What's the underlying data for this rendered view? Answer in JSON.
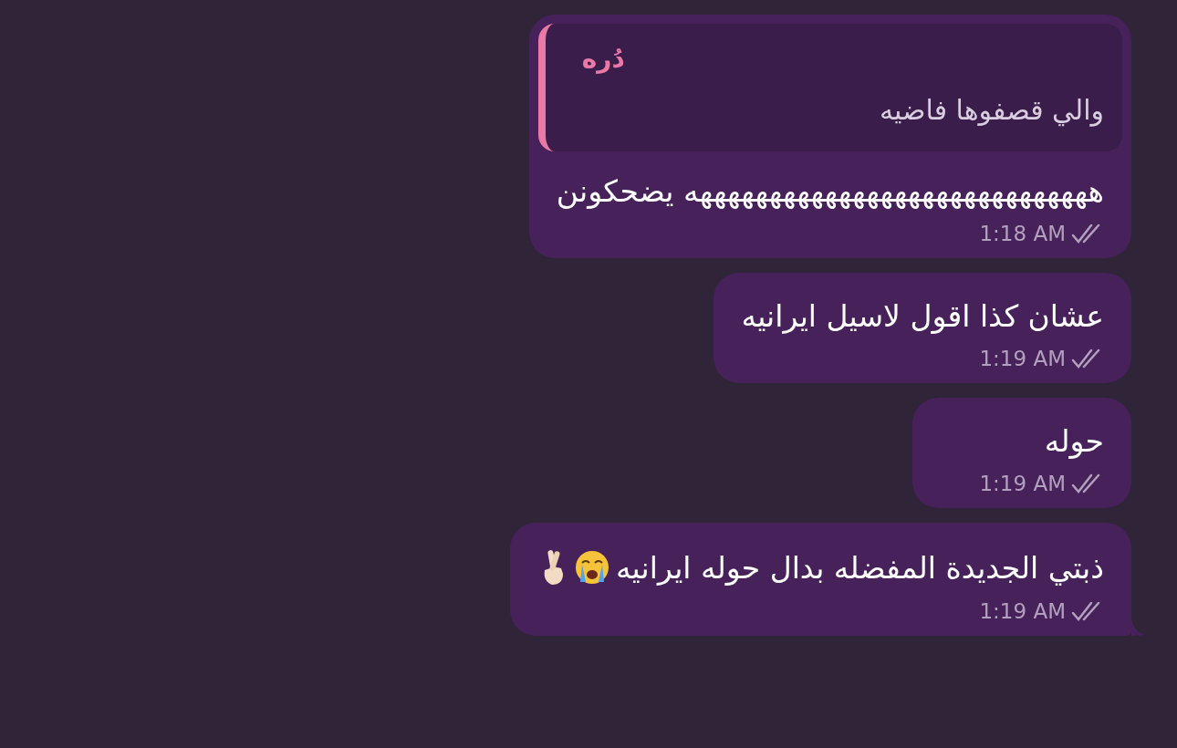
{
  "messages": [
    {
      "quote": {
        "author": "دُره",
        "text": "والي قصفوها فاضيه"
      },
      "text": "هههههههههههههههههههههههههههههه يضحكونن",
      "time": "1:18 AM",
      "read": true,
      "tail": false
    },
    {
      "text": "عشان كذا اقول لاسيل ايرانيه",
      "time": "1:19 AM",
      "read": true,
      "tail": false
    },
    {
      "text": "حوله",
      "time": "1:19 AM",
      "read": true,
      "tail": false
    },
    {
      "text": "ذبتي الجديدة المفضله بدال حوله ايرانيه",
      "emojis": [
        {
          "kind": "crying"
        },
        {
          "kind": "crossed-fingers"
        }
      ],
      "time": "1:19 AM",
      "read": true,
      "tail": true
    }
  ]
}
